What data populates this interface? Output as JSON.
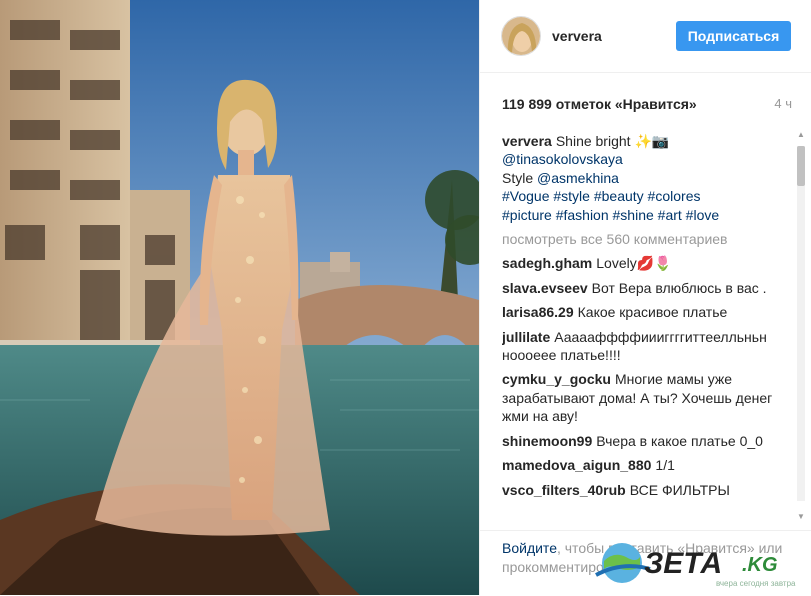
{
  "header": {
    "username": "ververa",
    "follow_label": "Подписаться"
  },
  "stats": {
    "likes": "119 899 отметок «Нравится»",
    "time": "4 ч"
  },
  "caption": {
    "user": "ververa",
    "line1": "Shine bright",
    "emoji": "✨📷",
    "mention_photo": "@tinasokolovskaya",
    "style_prefix": "Style",
    "mention_style": "@asmekhina",
    "hashtags_line1": "#Vogue #style #beauty #colores",
    "hashtags_line2": "#picture #fashion #shine #art #love"
  },
  "view_all": "посмотреть все 560 комментариев",
  "comments": [
    {
      "user": "sadegh.gham",
      "text": "Lovely💋🌷"
    },
    {
      "user": "slava.evseev",
      "text": "Вот Вера влюблюсь в вас ."
    },
    {
      "user": "larisa86.29",
      "text": "Какое красивое платье"
    },
    {
      "user": "jullilate",
      "text": "Аааааффффиииггггиттеелльньн нооoeee платье!!!!"
    },
    {
      "user": "cymku_y_gocku",
      "text": "Многие мамы уже зарабатывают дома! А ты? Хочешь денег жми на аву!"
    },
    {
      "user": "shinemoon99",
      "text": "Вчера в какое платье 0_0"
    },
    {
      "user": "mamedova_aigun_880",
      "text": "1/1"
    },
    {
      "user": "vsco_filters_40rub",
      "text": "ВСЕ ФИЛЬТРЫ"
    }
  ],
  "footer": {
    "login_link": "Войдите",
    "login_text": ", чтобы поставить «Нравится» или прокомментировать."
  },
  "watermark": {
    "brand_main": "ЗЕТА",
    "brand_suffix": ".KG",
    "tagline": "вчера сегодня завтра"
  },
  "icons": {
    "scroll_up": "triangle-up",
    "scroll_down": "triangle-down"
  },
  "colors": {
    "follow_button": "#3897f0",
    "link": "#003569",
    "muted": "#999999"
  }
}
